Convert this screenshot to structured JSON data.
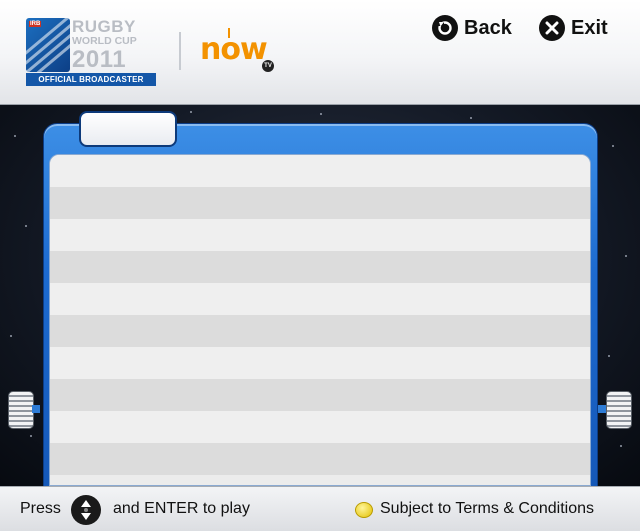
{
  "header": {
    "rwc_logo": {
      "line1": "RUGBY",
      "line2": "WORLD CUP",
      "line3": "2011",
      "banner": "OFFICIAL BROADCASTER",
      "badge": "IRB"
    },
    "now_logo": {
      "word": "now",
      "badge": "TV"
    },
    "back_label": "Back",
    "exit_label": "Exit"
  },
  "panel": {
    "tab_label": "",
    "rows": [
      "",
      "",
      "",
      "",
      "",
      "",
      "",
      "",
      "",
      ""
    ]
  },
  "footer": {
    "press_label": "Press",
    "enter_label": "and ENTER to play",
    "terms_label": "Subject to Terms & Conditions"
  },
  "colors": {
    "panel_blue": "#1d6bd0",
    "now_orange": "#f39200",
    "terms_yellow": "#e2c000"
  }
}
